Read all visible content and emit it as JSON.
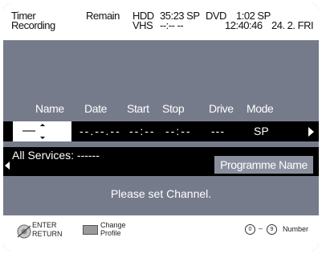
{
  "header": {
    "title_line1": "Timer",
    "title_line2": "Recording",
    "remain_label": "Remain",
    "hdd_label": "HDD",
    "hdd_remain": "35:23 SP",
    "vhs_label": "VHS",
    "vhs_remain": "--:--  --",
    "dvd_label": "DVD",
    "dvd_remain": "1:02 SP",
    "clock": "12:40:46",
    "date": "24. 2. FRI"
  },
  "columns": {
    "name": "Name",
    "date": "Date",
    "start": "Start",
    "stop": "Stop",
    "drive": "Drive",
    "mode": "Mode"
  },
  "entry": {
    "name_value": "—",
    "date_value": "--.--.--",
    "start_value": "--:--",
    "stop_value": "--:--",
    "drive_value": "---",
    "mode_value": "SP"
  },
  "services": {
    "label": "All Services: ------",
    "programme_name": "Programme Name"
  },
  "message": "Please set Channel.",
  "footer": {
    "enter": "ENTER",
    "return": "RETURN",
    "change_line1": "Change",
    "change_line2": "Profile",
    "key0": "0",
    "range_dash": "–",
    "key9": "9",
    "number": "Number"
  },
  "colors": {
    "panel": "#767b8c",
    "highlight_row": "#000000",
    "programme_button": "#8a8f9e"
  }
}
